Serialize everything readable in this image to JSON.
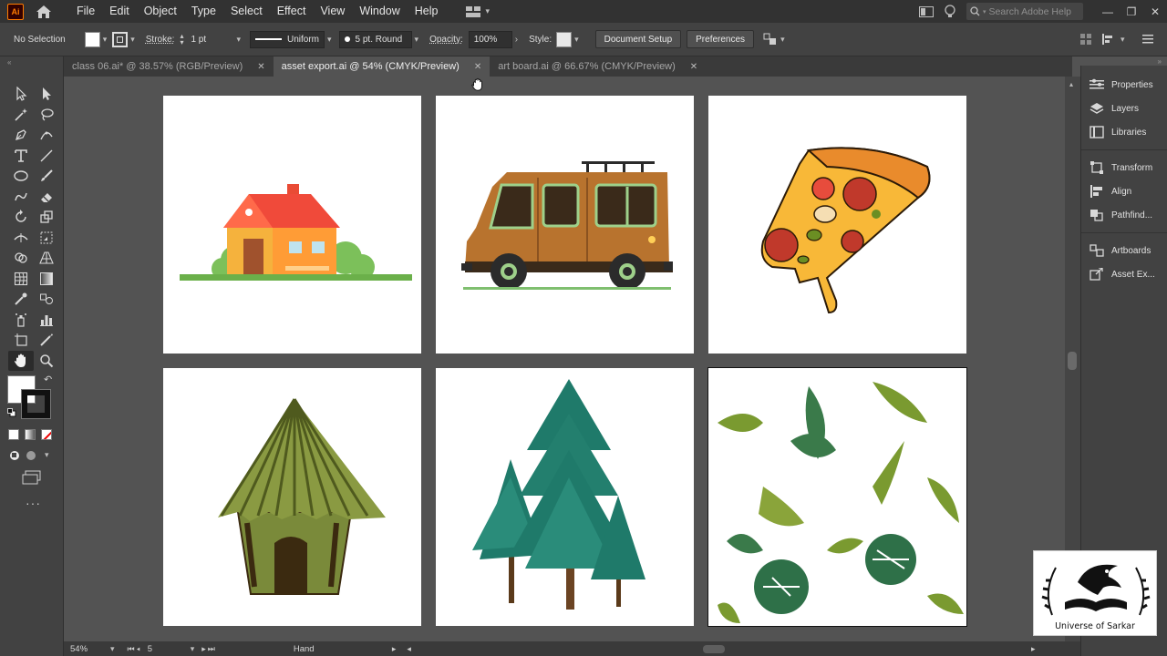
{
  "app": {
    "logo": "Ai"
  },
  "menus": [
    "File",
    "Edit",
    "Object",
    "Type",
    "Select",
    "Effect",
    "View",
    "Window",
    "Help"
  ],
  "search": {
    "placeholder": "Search Adobe Help"
  },
  "window_controls": [
    "—",
    "❐",
    "✕"
  ],
  "control": {
    "selection": "No Selection",
    "stroke_label": "Stroke:",
    "stroke_weight": "1 pt",
    "profile": "Uniform",
    "brush": "5 pt. Round",
    "opacity_label": "Opacity:",
    "opacity": "100%",
    "style_label": "Style:",
    "document_setup": "Document Setup",
    "preferences": "Preferences"
  },
  "tabs": [
    {
      "label": "class 06.ai* @ 38.57% (RGB/Preview)",
      "active": false
    },
    {
      "label": "asset export.ai @ 54% (CMYK/Preview)",
      "active": true
    },
    {
      "label": "art board.ai @ 66.67% (CMYK/Preview)",
      "active": false
    }
  ],
  "panels": [
    "Properties",
    "Layers",
    "Libraries",
    "Transform",
    "Align",
    "Pathfind...",
    "Artboards",
    "Asset Ex..."
  ],
  "status": {
    "zoom": "54%",
    "artboard": "5",
    "tool": "Hand"
  },
  "watermark": {
    "text": "Universe of Sarkar"
  },
  "colors": {
    "menubar": "#323232",
    "panel": "#424242",
    "canvas": "#535353",
    "accent": "#ff7c00"
  },
  "icons": {
    "tools": [
      "selection-tool-icon",
      "direct-selection-tool-icon",
      "magic-wand-tool-icon",
      "lasso-tool-icon",
      "pen-tool-icon",
      "curvature-tool-icon",
      "type-tool-icon",
      "line-tool-icon",
      "ellipse-tool-icon",
      "paintbrush-tool-icon",
      "shaper-tool-icon",
      "eraser-tool-icon",
      "rotate-tool-icon",
      "scale-tool-icon",
      "width-tool-icon",
      "free-transform-tool-icon",
      "shape-builder-tool-icon",
      "perspective-grid-tool-icon",
      "mesh-tool-icon",
      "gradient-tool-icon",
      "eyedropper-tool-icon",
      "blend-tool-icon",
      "symbol-sprayer-tool-icon",
      "column-graph-tool-icon",
      "artboard-tool-icon",
      "slice-tool-icon",
      "hand-tool-icon",
      "zoom-tool-icon"
    ]
  }
}
